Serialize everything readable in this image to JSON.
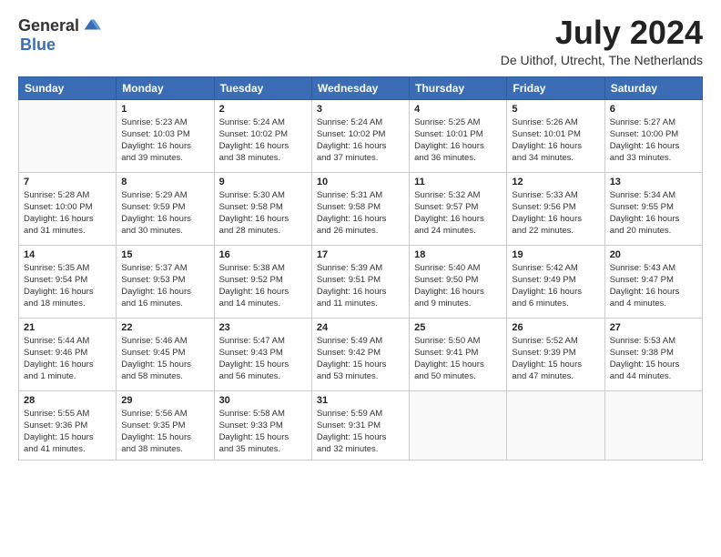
{
  "header": {
    "logo_general": "General",
    "logo_blue": "Blue",
    "title": "July 2024",
    "location": "De Uithof, Utrecht, The Netherlands"
  },
  "weekdays": [
    "Sunday",
    "Monday",
    "Tuesday",
    "Wednesday",
    "Thursday",
    "Friday",
    "Saturday"
  ],
  "weeks": [
    [
      {
        "day": "",
        "info": ""
      },
      {
        "day": "1",
        "info": "Sunrise: 5:23 AM\nSunset: 10:03 PM\nDaylight: 16 hours\nand 39 minutes."
      },
      {
        "day": "2",
        "info": "Sunrise: 5:24 AM\nSunset: 10:02 PM\nDaylight: 16 hours\nand 38 minutes."
      },
      {
        "day": "3",
        "info": "Sunrise: 5:24 AM\nSunset: 10:02 PM\nDaylight: 16 hours\nand 37 minutes."
      },
      {
        "day": "4",
        "info": "Sunrise: 5:25 AM\nSunset: 10:01 PM\nDaylight: 16 hours\nand 36 minutes."
      },
      {
        "day": "5",
        "info": "Sunrise: 5:26 AM\nSunset: 10:01 PM\nDaylight: 16 hours\nand 34 minutes."
      },
      {
        "day": "6",
        "info": "Sunrise: 5:27 AM\nSunset: 10:00 PM\nDaylight: 16 hours\nand 33 minutes."
      }
    ],
    [
      {
        "day": "7",
        "info": "Sunrise: 5:28 AM\nSunset: 10:00 PM\nDaylight: 16 hours\nand 31 minutes."
      },
      {
        "day": "8",
        "info": "Sunrise: 5:29 AM\nSunset: 9:59 PM\nDaylight: 16 hours\nand 30 minutes."
      },
      {
        "day": "9",
        "info": "Sunrise: 5:30 AM\nSunset: 9:58 PM\nDaylight: 16 hours\nand 28 minutes."
      },
      {
        "day": "10",
        "info": "Sunrise: 5:31 AM\nSunset: 9:58 PM\nDaylight: 16 hours\nand 26 minutes."
      },
      {
        "day": "11",
        "info": "Sunrise: 5:32 AM\nSunset: 9:57 PM\nDaylight: 16 hours\nand 24 minutes."
      },
      {
        "day": "12",
        "info": "Sunrise: 5:33 AM\nSunset: 9:56 PM\nDaylight: 16 hours\nand 22 minutes."
      },
      {
        "day": "13",
        "info": "Sunrise: 5:34 AM\nSunset: 9:55 PM\nDaylight: 16 hours\nand 20 minutes."
      }
    ],
    [
      {
        "day": "14",
        "info": "Sunrise: 5:35 AM\nSunset: 9:54 PM\nDaylight: 16 hours\nand 18 minutes."
      },
      {
        "day": "15",
        "info": "Sunrise: 5:37 AM\nSunset: 9:53 PM\nDaylight: 16 hours\nand 16 minutes."
      },
      {
        "day": "16",
        "info": "Sunrise: 5:38 AM\nSunset: 9:52 PM\nDaylight: 16 hours\nand 14 minutes."
      },
      {
        "day": "17",
        "info": "Sunrise: 5:39 AM\nSunset: 9:51 PM\nDaylight: 16 hours\nand 11 minutes."
      },
      {
        "day": "18",
        "info": "Sunrise: 5:40 AM\nSunset: 9:50 PM\nDaylight: 16 hours\nand 9 minutes."
      },
      {
        "day": "19",
        "info": "Sunrise: 5:42 AM\nSunset: 9:49 PM\nDaylight: 16 hours\nand 6 minutes."
      },
      {
        "day": "20",
        "info": "Sunrise: 5:43 AM\nSunset: 9:47 PM\nDaylight: 16 hours\nand 4 minutes."
      }
    ],
    [
      {
        "day": "21",
        "info": "Sunrise: 5:44 AM\nSunset: 9:46 PM\nDaylight: 16 hours\nand 1 minute."
      },
      {
        "day": "22",
        "info": "Sunrise: 5:46 AM\nSunset: 9:45 PM\nDaylight: 15 hours\nand 58 minutes."
      },
      {
        "day": "23",
        "info": "Sunrise: 5:47 AM\nSunset: 9:43 PM\nDaylight: 15 hours\nand 56 minutes."
      },
      {
        "day": "24",
        "info": "Sunrise: 5:49 AM\nSunset: 9:42 PM\nDaylight: 15 hours\nand 53 minutes."
      },
      {
        "day": "25",
        "info": "Sunrise: 5:50 AM\nSunset: 9:41 PM\nDaylight: 15 hours\nand 50 minutes."
      },
      {
        "day": "26",
        "info": "Sunrise: 5:52 AM\nSunset: 9:39 PM\nDaylight: 15 hours\nand 47 minutes."
      },
      {
        "day": "27",
        "info": "Sunrise: 5:53 AM\nSunset: 9:38 PM\nDaylight: 15 hours\nand 44 minutes."
      }
    ],
    [
      {
        "day": "28",
        "info": "Sunrise: 5:55 AM\nSunset: 9:36 PM\nDaylight: 15 hours\nand 41 minutes."
      },
      {
        "day": "29",
        "info": "Sunrise: 5:56 AM\nSunset: 9:35 PM\nDaylight: 15 hours\nand 38 minutes."
      },
      {
        "day": "30",
        "info": "Sunrise: 5:58 AM\nSunset: 9:33 PM\nDaylight: 15 hours\nand 35 minutes."
      },
      {
        "day": "31",
        "info": "Sunrise: 5:59 AM\nSunset: 9:31 PM\nDaylight: 15 hours\nand 32 minutes."
      },
      {
        "day": "",
        "info": ""
      },
      {
        "day": "",
        "info": ""
      },
      {
        "day": "",
        "info": ""
      }
    ]
  ]
}
